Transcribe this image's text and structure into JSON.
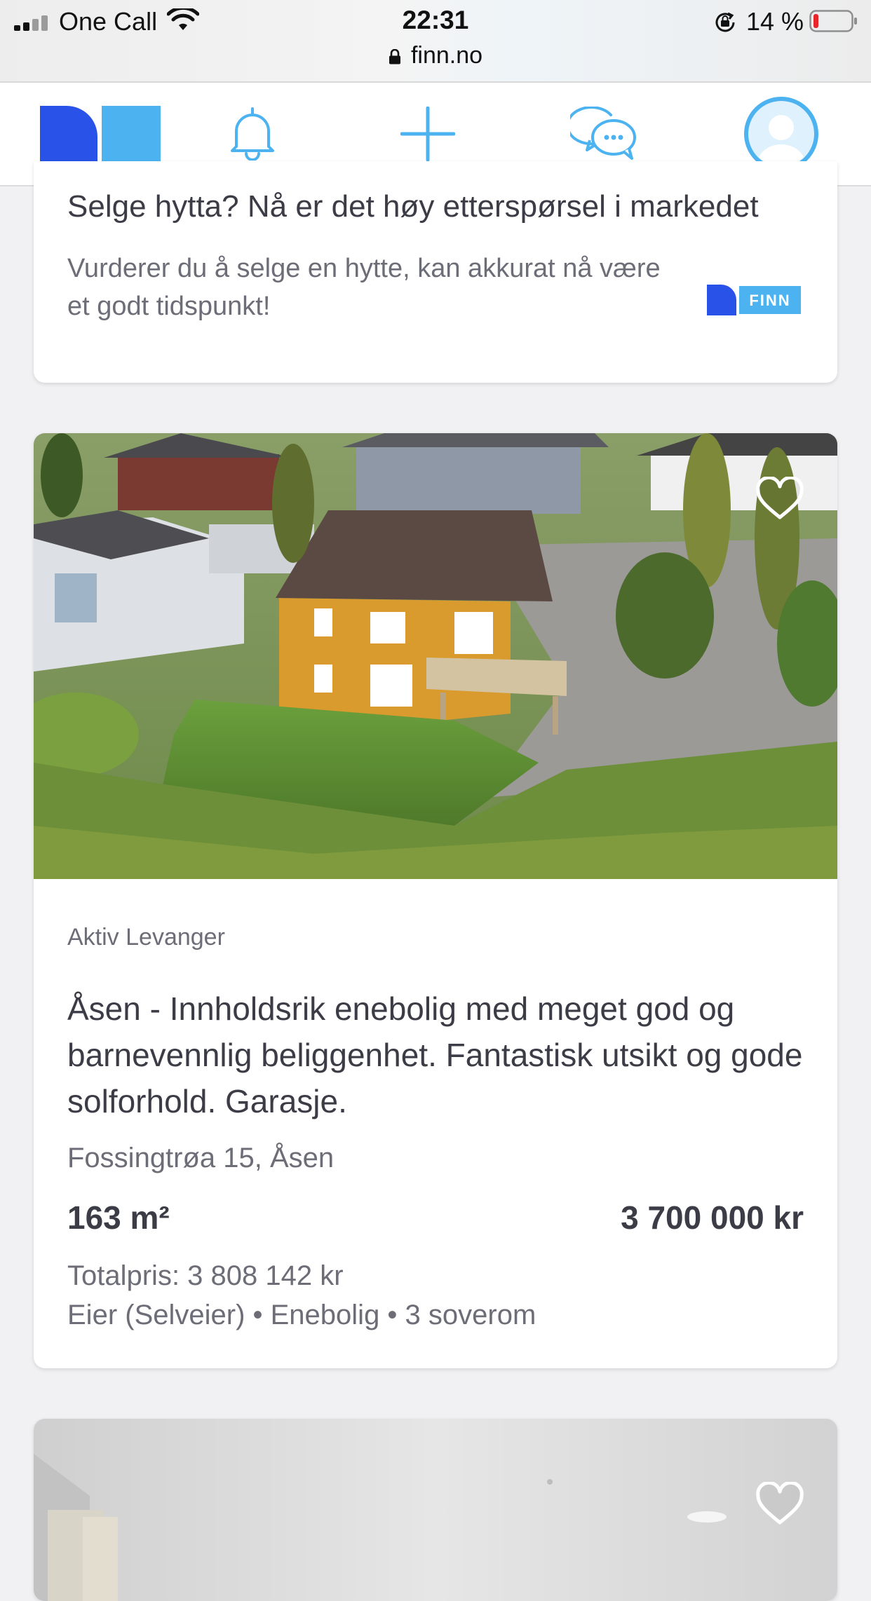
{
  "status_bar": {
    "carrier": "One Call",
    "time": "22:31",
    "url": "finn.no",
    "battery": "14 %"
  },
  "nav": {
    "items": [
      {
        "name": "home",
        "icon": "finn-logo-icon"
      },
      {
        "name": "notifications",
        "icon": "bell-icon"
      },
      {
        "name": "new-ad",
        "icon": "plus-icon"
      },
      {
        "name": "messages",
        "icon": "chat-icon"
      },
      {
        "name": "profile",
        "icon": "user-avatar-icon"
      }
    ],
    "accent": "#4db3f0",
    "brand_dark": "#2953e8"
  },
  "promo": {
    "title": "Selge hytta? Nå er det høy etterspørsel i markedet",
    "description": "Vurderer du å selge en hytte, kan akkurat nå være et godt tidspunkt!",
    "badge_text": "FINN"
  },
  "listing": {
    "agency": "Aktiv Levanger",
    "title": "Åsen - Innholdsrik enebolig med meget god og barnevennlig beliggenhet. Fantastisk utsikt og gode solforhold. Garasje.",
    "address": "Fossingtrøa 15, Åsen",
    "size": "163 m²",
    "price": "3 700 000 kr",
    "total_price": "Totalpris: 3 808 142 kr",
    "meta": "Eier (Selveier) • Enebolig • 3 soverom"
  }
}
